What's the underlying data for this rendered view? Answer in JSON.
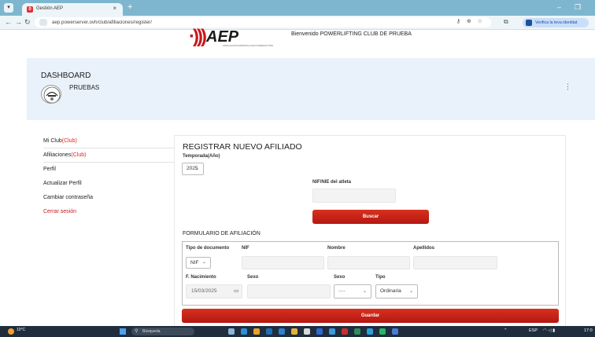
{
  "browser": {
    "tab_title": "Gestión AEP",
    "tab_close": "×",
    "new_tab": "+",
    "url": "aep.powerserver.ovh/club/afiliaciones/register/",
    "verify_label": "Verifica la teva identitat",
    "minimize": "–",
    "restore": "❐"
  },
  "header": {
    "logo_text": "AEP",
    "logo_sub": "ASOCIACIÓN ESPAÑOLA DE POWERLIFTING",
    "welcome": "Bienvenido POWERLIFTING CLUB DE PRUEBA"
  },
  "banner": {
    "title": "DASHBOARD",
    "club_name": "PRUEBAS",
    "menu_glyph": "⋮"
  },
  "sidebar": {
    "mi_club": "Mi Club",
    "mi_club_tag": "(Club)",
    "afiliaciones": "Afiliaciones",
    "afiliaciones_tag": "(Club)",
    "perfil": "Perfil",
    "actualizar": "Actualizar Perfil",
    "cambiar": "Cambiar contraseña",
    "cerrar": "Cerrar sesión"
  },
  "register": {
    "title": "REGISTRAR NUEVO AFILIADO",
    "season_label": "Temporada(Año)",
    "season_value": "2025",
    "nif_label": "NIF/NIE del atleta",
    "search_button": "Buscar"
  },
  "form": {
    "title": "FORMULARIO DE AFILIACIÓN",
    "doc_type_label": "Tipo de documento",
    "doc_type_value": "NIF",
    "nif_label": "NIF",
    "nombre_label": "Nombre",
    "apellidos_label": "Apellidos",
    "nacimiento_label": "F. Nacimiento",
    "nacimiento_value": "15/03/2025",
    "sexo_label": "Sexo",
    "sexo2_label": "Sexo",
    "sexo_value": "----",
    "tipo_label": "Tipo",
    "tipo_value": "Ordinaria",
    "save_button": "Guardar"
  },
  "taskbar": {
    "temp": "10°C",
    "search_placeholder": "Búsqueda",
    "lang": "ESP",
    "time": "17:0"
  }
}
